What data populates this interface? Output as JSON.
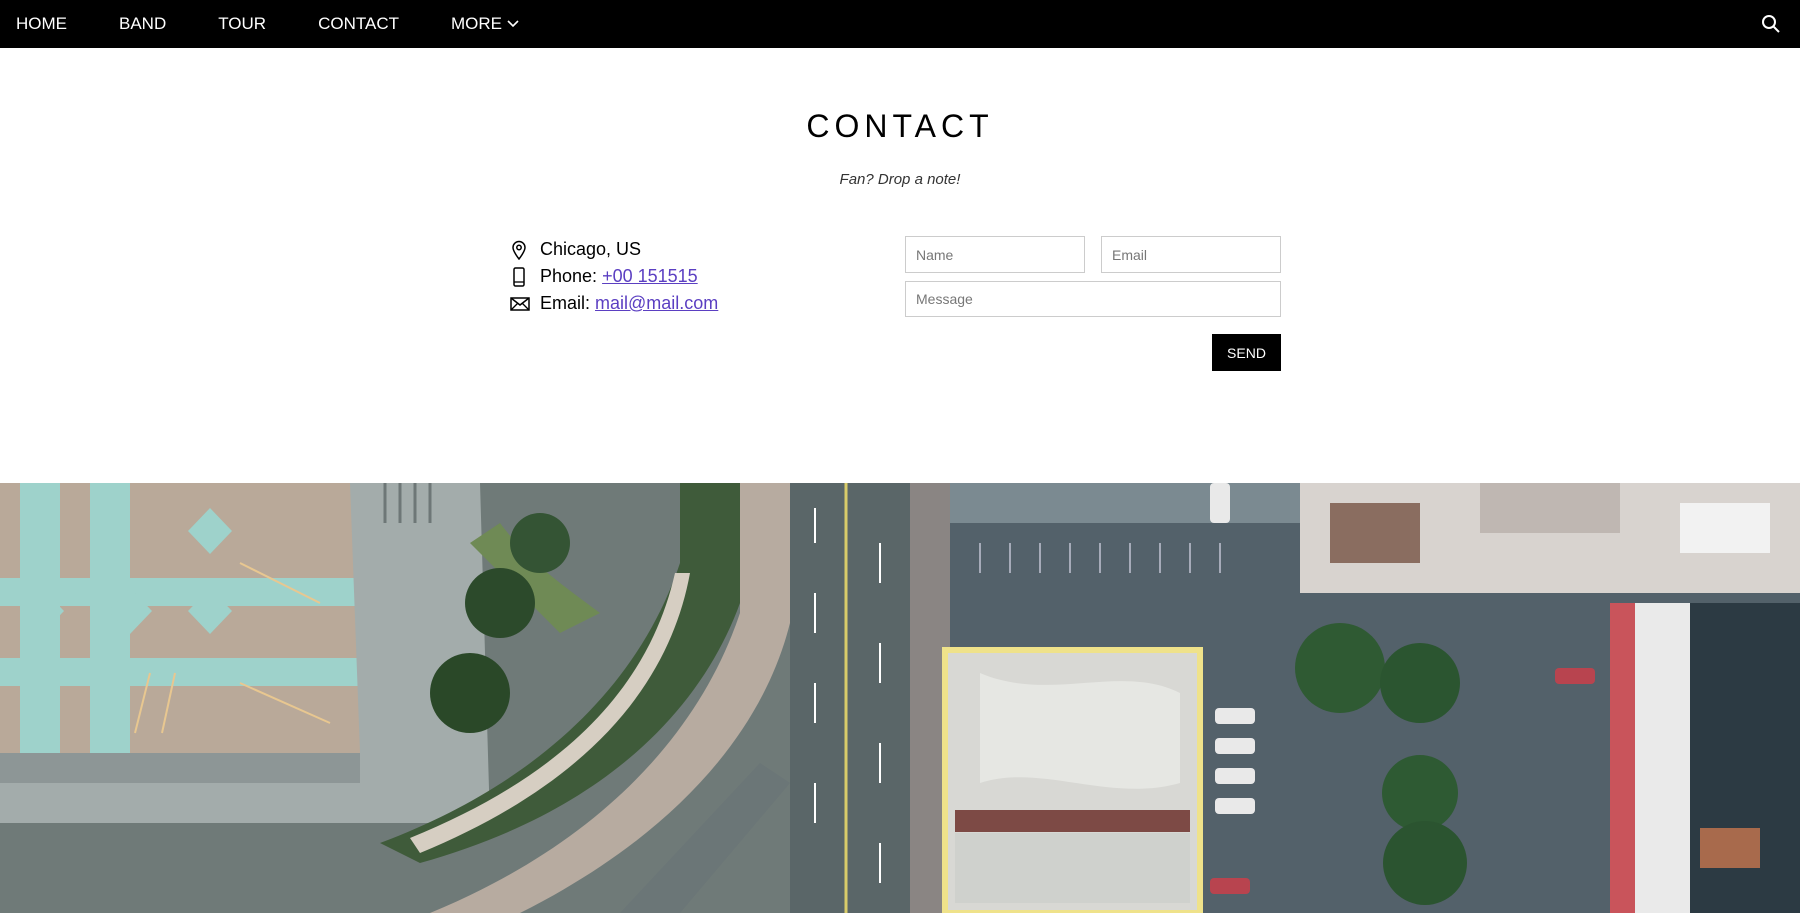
{
  "nav": {
    "items": [
      "HOME",
      "BAND",
      "TOUR",
      "CONTACT"
    ],
    "more_label": "MORE",
    "more_icon": "chevron-down-icon",
    "search_icon": "search-icon"
  },
  "contact": {
    "title": "CONTACT",
    "subtitle": "Fan? Drop a note!",
    "location": "Chicago, US",
    "phone_label": "Phone:",
    "phone_value": "+00 151515",
    "email_label": "Email:",
    "email_value": "mail@mail.com",
    "link_color": "#5b3fc2"
  },
  "form": {
    "name_placeholder": "Name",
    "email_placeholder": "Email",
    "message_placeholder": "Message",
    "send_label": "SEND"
  },
  "colors": {
    "navbar_bg": "#000000",
    "button_bg": "#000000",
    "accent_outline": "#efe28a"
  }
}
